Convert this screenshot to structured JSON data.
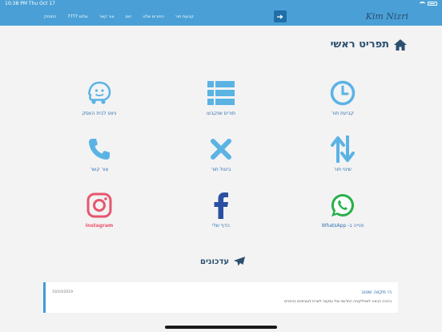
{
  "status_bar": {
    "time": "10:38 PM  Thu Oct 17"
  },
  "navbar": {
    "links": [
      "קביעת תור",
      "התורים שלנו",
      "הום",
      "צור קשר",
      "שלום 7777",
      "התנתק"
    ],
    "logo": "Kim Nizri"
  },
  "page": {
    "title": "תפריט ראשי"
  },
  "tiles": [
    {
      "label": "קביעת תור",
      "icon": "clock-icon"
    },
    {
      "label": "תורים שנקבעו",
      "icon": "list-icon"
    },
    {
      "label": "ניווט לבית העסק",
      "icon": "waze-icon"
    },
    {
      "label": "שינוי תור",
      "icon": "swap-arrows-icon"
    },
    {
      "label": "ביטול תור",
      "icon": "x-icon"
    },
    {
      "label": "צור קשר",
      "icon": "phone-icon"
    },
    {
      "label": "פנייה ב- WhatsApp",
      "icon": "whatsapp-icon"
    },
    {
      "label": "הדף שלי",
      "icon": "facebook-icon"
    },
    {
      "label": "Instagram",
      "icon": "instagram-icon"
    }
  ],
  "updates": {
    "title": "עדכונים",
    "card": {
      "heading": "הי מקווה שטוב",
      "body": "ברוכה הבאה לאפליקציה החדשה שלי ומקווה לשרת לטובתכם בכתבים",
      "date": "10/10/2019"
    }
  },
  "colors": {
    "accent": "#4aa0d6",
    "icon_blue": "#5bb3e4",
    "title": "#2b4f6f",
    "whatsapp": "#28b14a",
    "instagram": "#e8566c",
    "facebook": "#2b4fa1"
  }
}
